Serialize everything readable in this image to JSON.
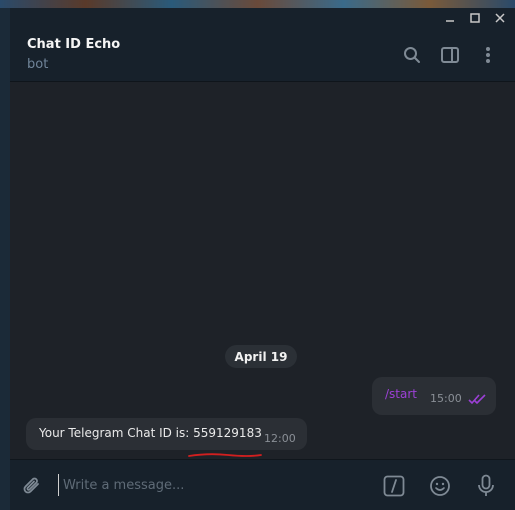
{
  "window": {
    "controls": [
      {
        "icon": "minimize-icon"
      },
      {
        "icon": "maximize-icon"
      },
      {
        "icon": "close-icon"
      }
    ]
  },
  "header": {
    "title": "Chat ID Echo",
    "status": "bot",
    "icons": [
      "search-icon",
      "sidebar-toggle-icon",
      "more-options-icon"
    ]
  },
  "chat": {
    "date_separator": "April 19",
    "messages": [
      {
        "direction": "outgoing",
        "text": "/start",
        "time": "15:00",
        "status_icon": "double-check-icon"
      },
      {
        "direction": "incoming",
        "text": "Your Telegram Chat ID is: 559129183",
        "time": "12:00"
      }
    ]
  },
  "composer": {
    "placeholder": "Write a message...",
    "icons": [
      "paperclip-icon",
      "bot-command-icon",
      "emoji-icon",
      "microphone-icon"
    ]
  },
  "colors": {
    "command_text": "#9c40d6",
    "read_checks": "#9c40d6",
    "annotation_underline": "#d21f1f"
  }
}
